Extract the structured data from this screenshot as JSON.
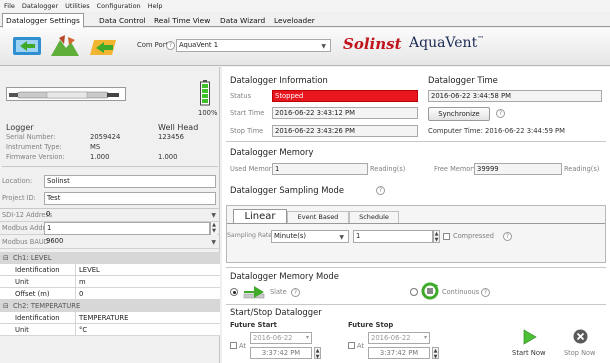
{
  "menu": [
    "File",
    "Datalogger",
    "Utilities",
    "Configuration",
    "Help"
  ],
  "tabs": [
    "Datalogger Settings",
    "Data Control",
    "Real Time View",
    "Data Wizard",
    "Leveloader"
  ],
  "toolbar": {
    "com_port_label": "Com Port:",
    "com_port_value": "AquaVent 1"
  },
  "branding": {
    "brand1": "Solinst",
    "brand2": "AquaVent",
    "trademark": "™"
  },
  "logger": {
    "battery": "100%",
    "col_logger": "Logger",
    "col_wellhead": "Well Head",
    "rows": [
      {
        "label": "Serial Number:",
        "logger": "2059424",
        "wellhead": "123456"
      },
      {
        "label": "Instrument Type:",
        "logger": "MS",
        "wellhead": ""
      },
      {
        "label": "Firmware Version:",
        "logger": "1.000",
        "wellhead": "1.000"
      }
    ],
    "location_label": "Location:",
    "location_value": "Solinst",
    "project_label": "Project ID:",
    "project_value": "Test",
    "sdi_label": "SDI-12 Address",
    "sdi_value": "0",
    "modbus_label": "Modbus Address",
    "modbus_value": "1",
    "baud_label": "Modbus BAUD",
    "baud_value": "9600"
  },
  "channels": [
    {
      "title": "Ch1: LEVEL",
      "rows": [
        {
          "k": "Identification",
          "v": "LEVEL"
        },
        {
          "k": "Unit",
          "v": "m"
        },
        {
          "k": "Offset (m)",
          "v": "0"
        }
      ]
    },
    {
      "title": "Ch2: TEMPERATURE",
      "rows": [
        {
          "k": "Identification",
          "v": "TEMPERATURE"
        },
        {
          "k": "Unit",
          "v": "°C"
        }
      ]
    }
  ],
  "info": {
    "title": "Datalogger Information",
    "status_label": "Status",
    "status_value": "Stopped",
    "start_label": "Start Time",
    "start_value": "2016-06-22 3:43:12 PM",
    "stop_label": "Stop Time",
    "stop_value": "2016-06-22 3:43:26 PM"
  },
  "time": {
    "title": "Datalogger Time",
    "value": "2016-06-22 3:44:58 PM",
    "sync_label": "Synchronize",
    "computer_time": "Computer Time: 2016-06-22 3:44:59 PM"
  },
  "memory": {
    "title": "Datalogger Memory",
    "used_label": "Used Memory",
    "used_value": "1",
    "used_unit": "Reading(s)",
    "free_label": "Free Memory",
    "free_value": "39999",
    "free_unit": "Reading(s)"
  },
  "sampling": {
    "title": "Datalogger Sampling Mode",
    "tabs": [
      "Linear",
      "Event Based",
      "Schedule"
    ],
    "rate_label": "Sampling Rate",
    "rate_unit": "Minute(s)",
    "rate_value": "1",
    "compressed_label": "Compressed"
  },
  "mem_mode": {
    "title": "Datalogger Memory Mode",
    "slate": "Slate",
    "continuous": "Continuous"
  },
  "startstop": {
    "title": "Start/Stop Datalogger",
    "future_start": "Future Start",
    "future_stop": "Future Stop",
    "at": "At",
    "start_date": "2016-06-22",
    "start_time": "3:37:42 PM",
    "stop_date": "2016-06-22",
    "stop_time": "3:37:42 PM",
    "start_now": "Start Now",
    "stop_now": "Stop Now"
  },
  "colors": {
    "status_bg": "#e8161f",
    "brand_red": "#c0141c",
    "battery_green": "#3fbf2a"
  }
}
